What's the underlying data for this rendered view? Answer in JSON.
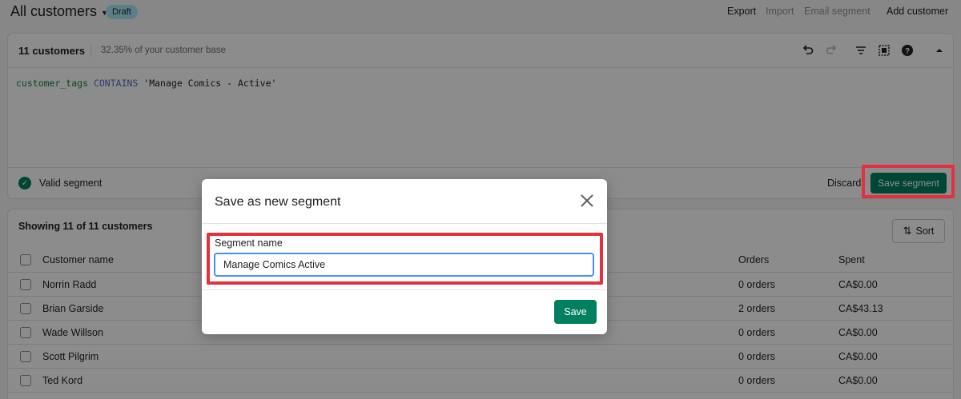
{
  "header": {
    "title": "All customers",
    "badge": "Draft",
    "actions": {
      "export": "Export",
      "import": "Import",
      "email_segment": "Email segment",
      "add_customer": "Add customer"
    }
  },
  "editor": {
    "count": "11 customers",
    "percentage": "32.35% of your customer base",
    "icons": [
      "undo-icon",
      "redo-icon",
      "filter-icon",
      "columns-icon",
      "help-icon",
      "collapse-icon"
    ],
    "query": {
      "field": "customer_tags",
      "operator": "CONTAINS",
      "value": "'Manage Comics - Active'"
    },
    "status": "Valid segment",
    "discard": "Discard",
    "save_segment": "Save segment"
  },
  "table": {
    "showing": "Showing 11 of 11 customers",
    "sort": "Sort",
    "columns": {
      "name": "Customer name",
      "orders": "Orders",
      "spent": "Spent"
    },
    "rows": [
      {
        "name": "Norrin Radd",
        "orders": "0 orders",
        "spent": "CA$0.00"
      },
      {
        "name": "Brian Garside",
        "orders": "2 orders",
        "spent": "CA$43.13"
      },
      {
        "name": "Wade Willson",
        "orders": "0 orders",
        "spent": "CA$0.00"
      },
      {
        "name": "Scott Pilgrim",
        "orders": "0 orders",
        "spent": "CA$0.00"
      },
      {
        "name": "Ted Kord",
        "orders": "0 orders",
        "spent": "CA$0.00"
      }
    ]
  },
  "modal": {
    "title": "Save as new segment",
    "field_label": "Segment name",
    "field_value": "Manage Comics Active",
    "save": "Save"
  },
  "colors": {
    "primary": "#008060",
    "highlight": "#e3323e",
    "badge": "#a4e8f2",
    "focus": "#458fff"
  }
}
